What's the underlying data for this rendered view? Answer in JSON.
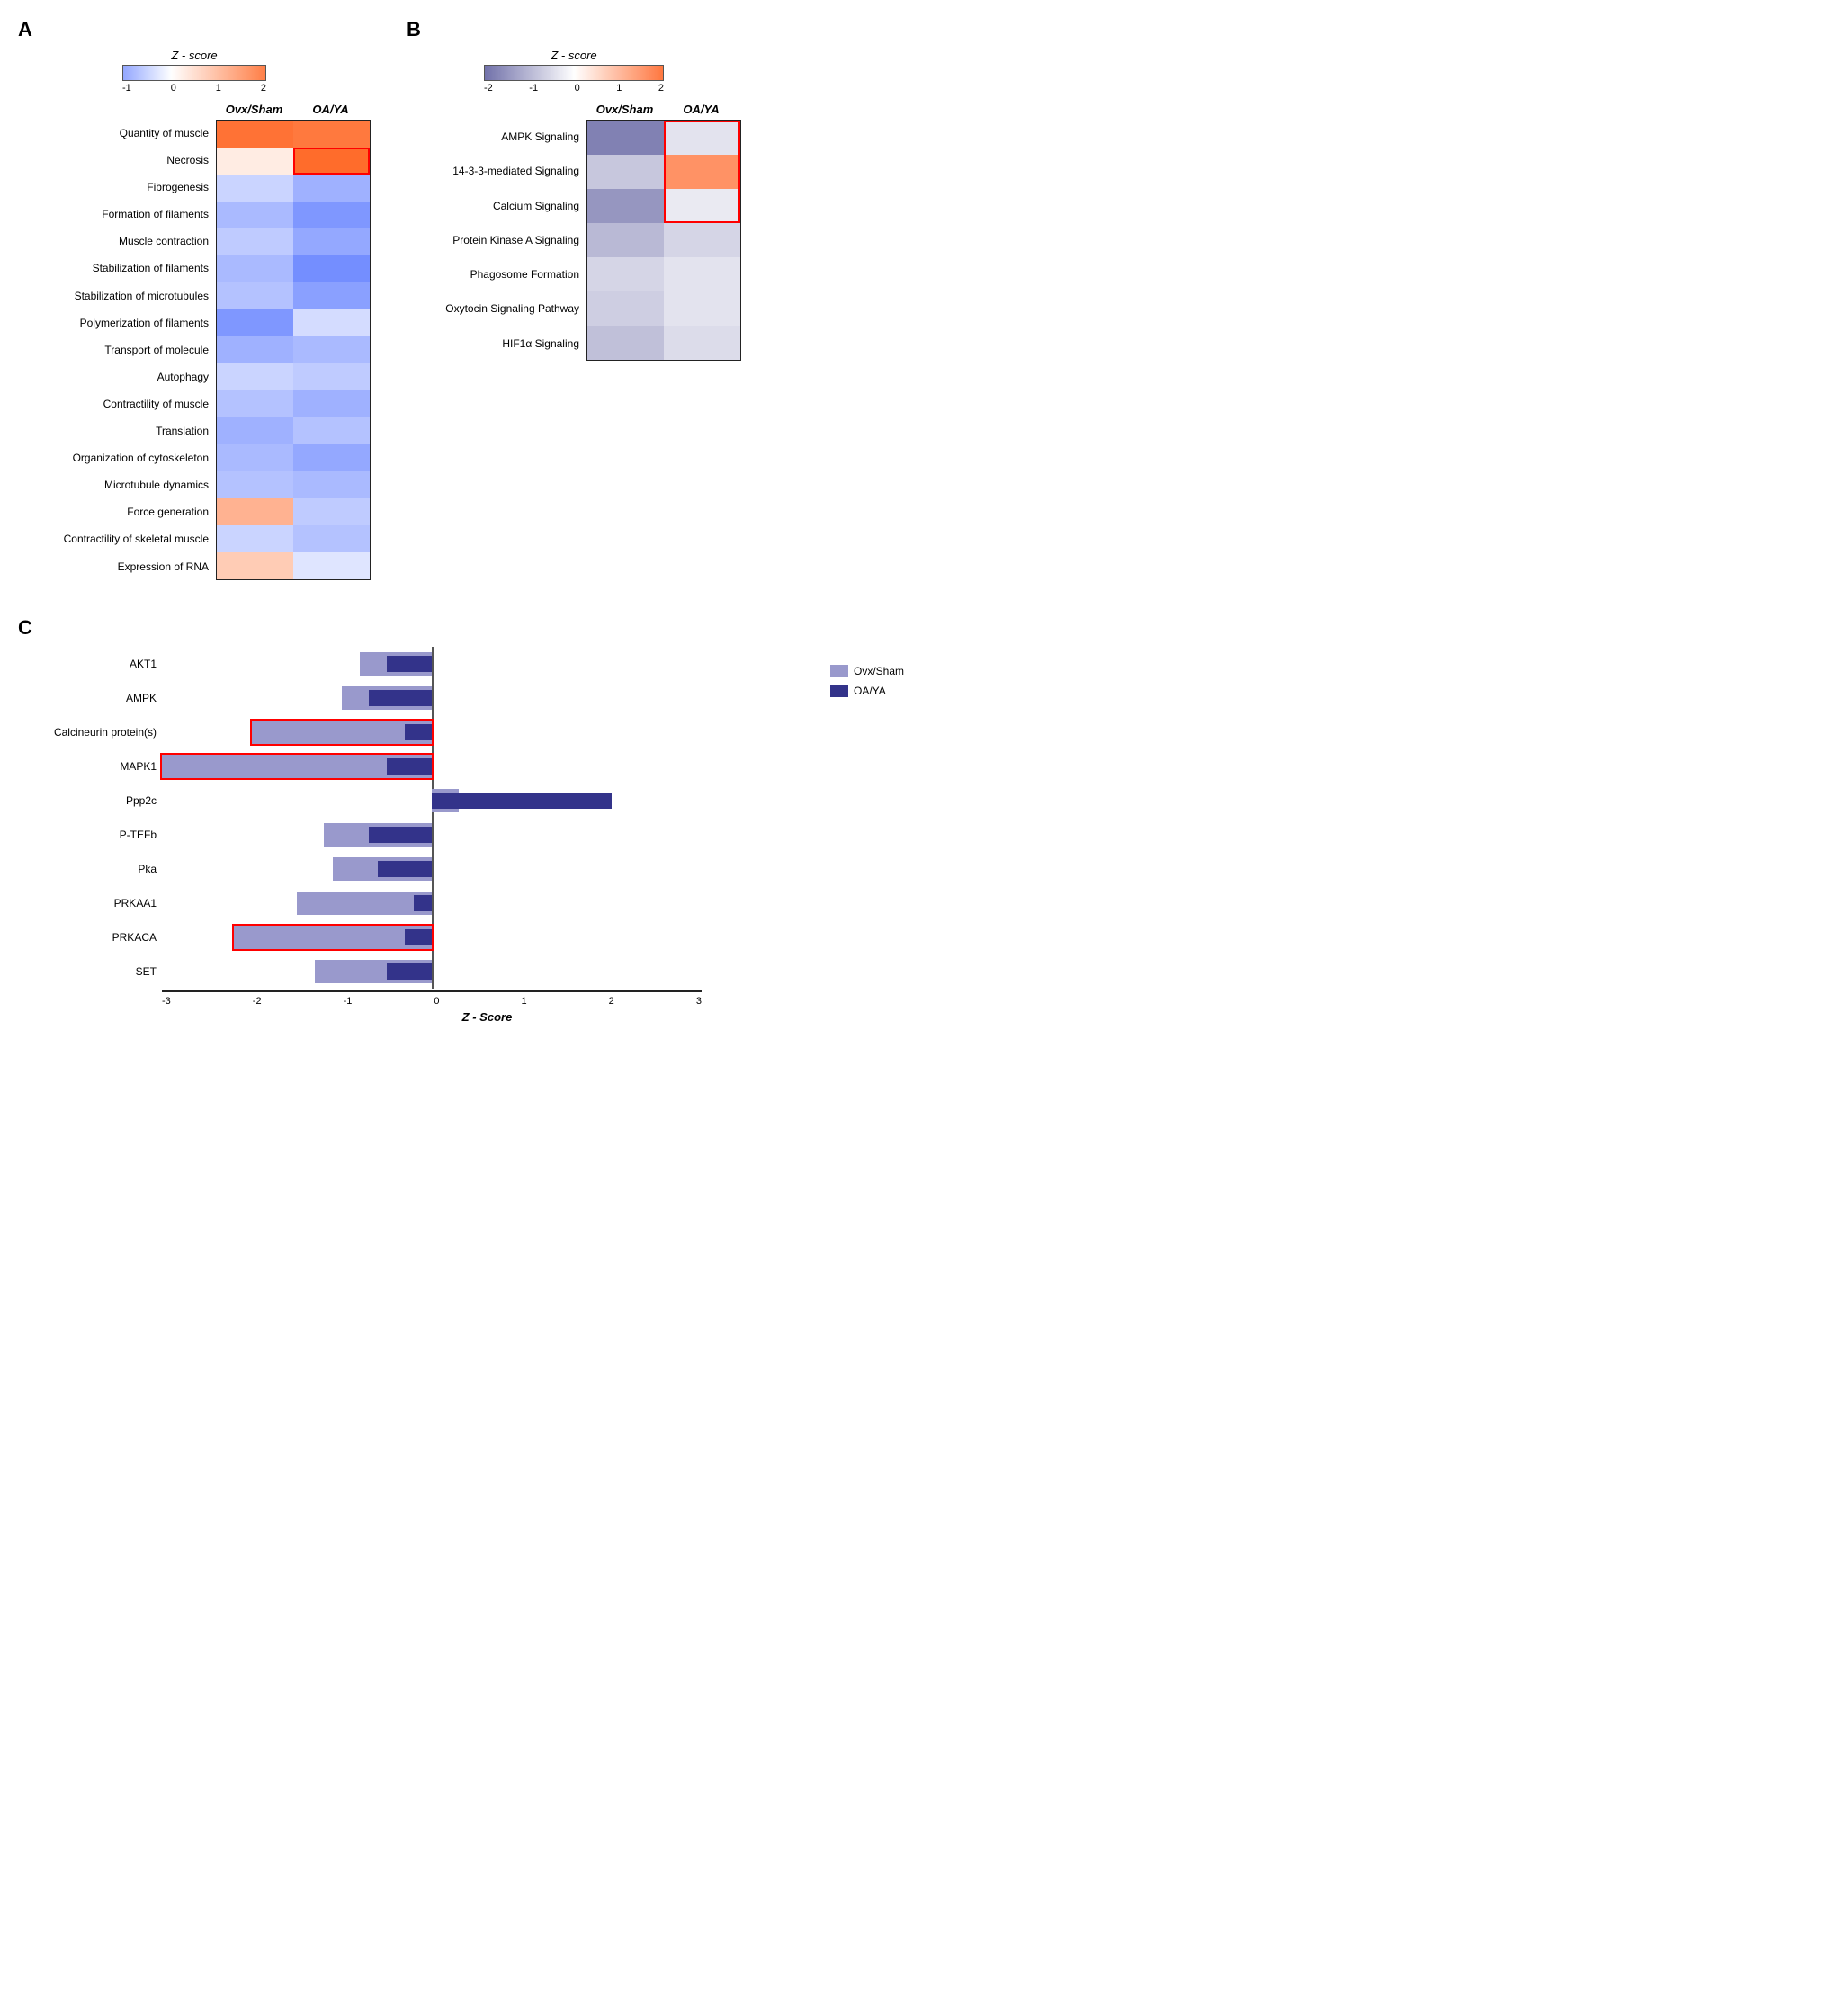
{
  "panels": {
    "A": {
      "label": "A",
      "colorbar": {
        "title": "Z - score",
        "ticks": [
          "-1",
          "0",
          "1",
          "2"
        ]
      },
      "col_headers": [
        "Ovx/Sham",
        "OA/YA"
      ],
      "col_header_widths": [
        85,
        85
      ],
      "rows": [
        {
          "label": "Quantity of muscle",
          "ovx": 2.2,
          "oa": 2.1
        },
        {
          "label": "Necrosis",
          "ovx": 0.3,
          "oa": 2.3
        },
        {
          "label": "Fibrogenesis",
          "ovx": -0.5,
          "oa": -0.9
        },
        {
          "label": "Formation of filaments",
          "ovx": -0.8,
          "oa": -1.2
        },
        {
          "label": "Muscle contraction",
          "ovx": -0.6,
          "oa": -1.0
        },
        {
          "label": "Stabilization of filaments",
          "ovx": -0.8,
          "oa": -1.3
        },
        {
          "label": "Stabilization of microtubules",
          "ovx": -0.7,
          "oa": -1.1
        },
        {
          "label": "Polymerization of filaments",
          "ovx": -1.2,
          "oa": -0.4
        },
        {
          "label": "Transport of molecule",
          "ovx": -0.9,
          "oa": -0.8
        },
        {
          "label": "Autophagy",
          "ovx": -0.5,
          "oa": -0.6
        },
        {
          "label": "Contractility of muscle",
          "ovx": -0.7,
          "oa": -0.9
        },
        {
          "label": "Translation",
          "ovx": -0.9,
          "oa": -0.7
        },
        {
          "label": "Organization of cytoskeleton",
          "ovx": -0.8,
          "oa": -1.0
        },
        {
          "label": "Microtubule dynamics",
          "ovx": -0.7,
          "oa": -0.8
        },
        {
          "label": "Force generation",
          "ovx": 1.2,
          "oa": -0.6
        },
        {
          "label": "Contractility of skeletal muscle",
          "ovx": -0.5,
          "oa": -0.7
        },
        {
          "label": "Expression of RNA",
          "ovx": 0.8,
          "oa": -0.3
        }
      ],
      "red_box": {
        "row_start": 1,
        "row_end": 2,
        "col_start": 1,
        "col_end": 2
      }
    },
    "B": {
      "label": "B",
      "colorbar": {
        "title": "Z - score",
        "ticks": [
          "-2",
          "-1",
          "0",
          "1",
          "2"
        ]
      },
      "col_headers": [
        "Ovx/Sham",
        "OA/YA"
      ],
      "rows": [
        {
          "label": "AMPK Signaling",
          "ovx": -1.8,
          "oa": -0.4
        },
        {
          "label": "14-3-3-mediated Signaling",
          "ovx": -0.8,
          "oa": 1.6
        },
        {
          "label": "Calcium Signaling",
          "ovx": -1.5,
          "oa": -0.3
        },
        {
          "label": "Protein Kinase A Signaling",
          "ovx": -1.0,
          "oa": -0.6
        },
        {
          "label": "Phagosome Formation",
          "ovx": -0.6,
          "oa": -0.4
        },
        {
          "label": "Oxytocin Signaling Pathway",
          "ovx": -0.7,
          "oa": -0.4
        },
        {
          "label": "HIF1α Signaling",
          "ovx": -0.9,
          "oa": -0.5
        }
      ],
      "red_box": {
        "row_start": 0,
        "row_end": 2,
        "col_start": 1,
        "col_end": 2
      }
    },
    "C": {
      "label": "C",
      "legend": {
        "ovx_label": "Ovx/Sham",
        "oa_label": "OA/YA",
        "ovx_color": "#9999cc",
        "oa_color": "#33338a"
      },
      "x_axis_title": "Z - Score",
      "x_ticks": [
        "-3",
        "-2",
        "-1",
        "0",
        "1",
        "2",
        "3"
      ],
      "rows": [
        {
          "label": "AKT1",
          "ovx": -0.8,
          "oa": -0.5
        },
        {
          "label": "AMPK",
          "ovx": -1.0,
          "oa": -0.7
        },
        {
          "label": "Calcineurin protein(s)",
          "ovx": -2.0,
          "oa": -0.3
        },
        {
          "label": "MAPK1",
          "ovx": -3.0,
          "oa": -0.5
        },
        {
          "label": "Ppp2c",
          "ovx": 0.3,
          "oa": 2.0
        },
        {
          "label": "P-TEFb",
          "ovx": -1.2,
          "oa": -0.7
        },
        {
          "label": "Pka",
          "ovx": -1.1,
          "oa": -0.6
        },
        {
          "label": "PRKAA1",
          "ovx": -1.5,
          "oa": -0.2
        },
        {
          "label": "PRKACA",
          "ovx": -2.2,
          "oa": -0.3
        },
        {
          "label": "SET",
          "ovx": -1.3,
          "oa": -0.5
        }
      ],
      "red_rows": [
        2,
        3,
        8
      ]
    }
  }
}
